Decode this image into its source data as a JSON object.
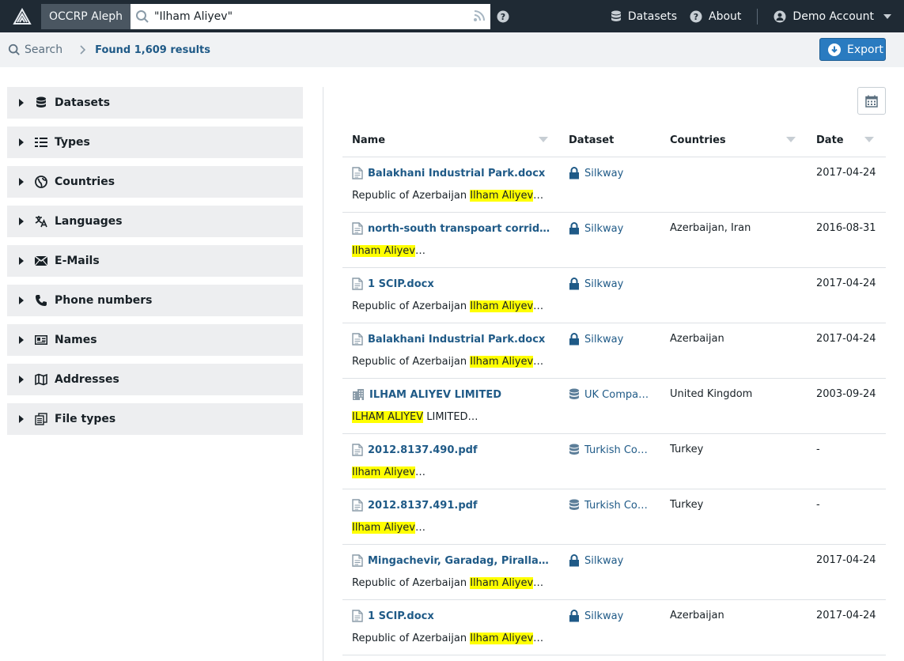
{
  "navbar": {
    "brand": "OCCRP Aleph",
    "search_value": "\"Ilham Aliyev\"",
    "datasets_label": "Datasets",
    "about_label": "About",
    "account_label": "Demo Account"
  },
  "breadcrumb": {
    "search_label": "Search",
    "found_label": "Found 1,609 results",
    "export_label": "Export"
  },
  "facets": [
    {
      "label": "Datasets",
      "icon": "database-icon"
    },
    {
      "label": "Types",
      "icon": "list-columns-icon"
    },
    {
      "label": "Countries",
      "icon": "globe-icon"
    },
    {
      "label": "Languages",
      "icon": "translate-icon"
    },
    {
      "label": "E-Mails",
      "icon": "envelope-icon"
    },
    {
      "label": "Phone numbers",
      "icon": "phone-icon"
    },
    {
      "label": "Names",
      "icon": "id-card-icon"
    },
    {
      "label": "Addresses",
      "icon": "map-icon"
    },
    {
      "label": "File types",
      "icon": "documents-icon"
    }
  ],
  "table": {
    "headers": {
      "name": "Name",
      "dataset": "Dataset",
      "countries": "Countries",
      "date": "Date"
    },
    "rows": [
      {
        "name": "Balakhani Industrial Park.docx",
        "icon": "document-icon",
        "dataset": "Silkway",
        "ds_icon": "lock-icon",
        "countries": "",
        "date": "2017-04-24",
        "snip_pre": "Republic of Azerbaijan ",
        "snip_hl": "Ilham Aliyev",
        "snip_post": "…"
      },
      {
        "name": "north-south transpoart corridor.d…",
        "icon": "document-icon",
        "dataset": "Silkway",
        "ds_icon": "lock-icon",
        "countries": "Azerbaijan, Iran",
        "date": "2016-08-31",
        "snip_pre": "",
        "snip_hl": "Ilham Aliyev",
        "snip_post": "…"
      },
      {
        "name": "1 SCIP.docx",
        "icon": "document-icon",
        "dataset": "Silkway",
        "ds_icon": "lock-icon",
        "countries": "",
        "date": "2017-04-24",
        "snip_pre": "Republic of Azerbaijan ",
        "snip_hl": "Ilham Aliyev",
        "snip_post": "…"
      },
      {
        "name": "Balakhani Industrial Park.docx",
        "icon": "document-icon",
        "dataset": "Silkway",
        "ds_icon": "lock-icon",
        "countries": "Azerbaijan",
        "date": "2017-04-24",
        "snip_pre": "Republic of Azerbaijan ",
        "snip_hl": "Ilham Aliyev",
        "snip_post": "…"
      },
      {
        "name": "ILHAM ALIYEV LIMITED",
        "icon": "company-icon",
        "dataset": "UK Compa…",
        "ds_icon": "database-icon",
        "countries": "United Kingdom",
        "date": "2003-09-24",
        "snip_pre": "",
        "snip_hl": "ILHAM ALIYEV",
        "snip_post": " LIMITED…"
      },
      {
        "name": "2012.8137.490.pdf",
        "icon": "document-icon",
        "dataset": "Turkish Co…",
        "ds_icon": "database-icon",
        "countries": "Turkey",
        "date": "-",
        "snip_pre": "",
        "snip_hl": "Ilham Aliyev",
        "snip_post": "…"
      },
      {
        "name": "2012.8137.491.pdf",
        "icon": "document-icon",
        "dataset": "Turkish Co…",
        "ds_icon": "database-icon",
        "countries": "Turkey",
        "date": "-",
        "snip_pre": "",
        "snip_hl": "Ilham Aliyev",
        "snip_post": "…"
      },
      {
        "name": "Mingachevir, Garadag, Pirallahi.d…",
        "icon": "document-icon",
        "dataset": "Silkway",
        "ds_icon": "lock-icon",
        "countries": "",
        "date": "2017-04-24",
        "snip_pre": "Republic of Azerbaijan ",
        "snip_hl": "Ilham Aliyev",
        "snip_post": "…"
      },
      {
        "name": "1 SCIP.docx",
        "icon": "document-icon",
        "dataset": "Silkway",
        "ds_icon": "lock-icon",
        "countries": "Azerbaijan",
        "date": "2017-04-24",
        "snip_pre": "Republic of Azerbaijan ",
        "snip_hl": "Ilham Aliyev",
        "snip_post": "…"
      }
    ]
  },
  "colors": {
    "navbar_bg": "#1f2a34",
    "link": "#1f5a87",
    "highlight": "#ffff00",
    "export_bg": "#2a7bc0"
  }
}
